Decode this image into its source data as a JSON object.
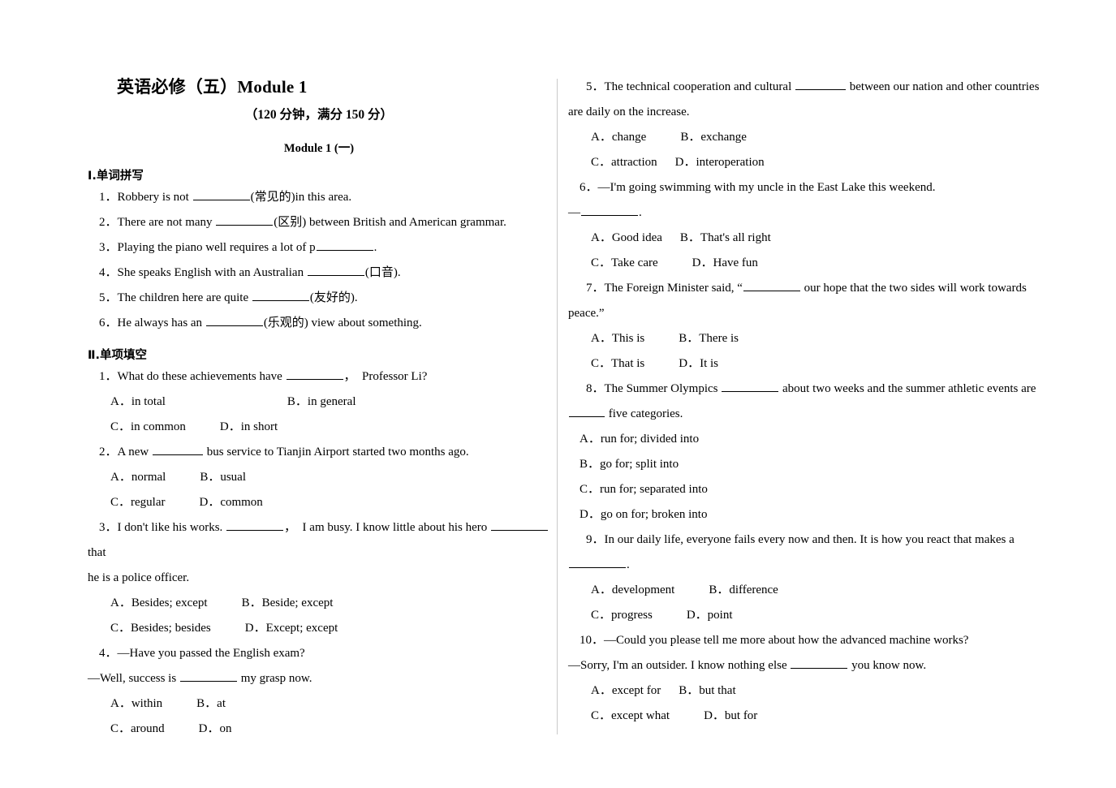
{
  "document": {
    "title": "英语必修（五）Module 1",
    "subtitle": "（120 分钟，满分 150 分）",
    "module_sub": "Module 1 (一)"
  },
  "sections": [
    {
      "id": "spelling",
      "heading": "Ⅰ.单词拼写"
    },
    {
      "id": "multiple_choice",
      "heading": "Ⅱ.单项填空"
    }
  ],
  "spelling_items": [
    {
      "num": "1．",
      "pre": "Robbery is not ",
      "post": "(常见的)in this area."
    },
    {
      "num": "2．",
      "pre": "There are not many ",
      "post": "(区别) between British and American grammar."
    },
    {
      "num": "3．",
      "pre": "Playing the piano well requires a lot of p",
      "post": "."
    },
    {
      "num": "4．",
      "pre": "She speaks English with an Australian ",
      "post": "(口音)."
    },
    {
      "num": "5．",
      "pre": "The children here are quite ",
      "post": "(友好的)."
    },
    {
      "num": "6．",
      "pre": "He always has an ",
      "post": "(乐观的) view about something."
    }
  ],
  "mc_left": [
    {
      "num": "1．",
      "stem_pre": "What do these achievements have ",
      "stem_post": "，　Professor Li?",
      "row1_a": "A．in total",
      "row1_b": "B．in general",
      "row2_a": "C．in common",
      "row2_b": "D．in short"
    },
    {
      "num": "2．",
      "stem_pre": "A new ",
      "stem_post": " bus service to Tianjin Airport started two months ago.",
      "row1_a": "A．normal",
      "row1_b": "B．usual",
      "row2_a": "C．regular",
      "row2_b": "D．common"
    },
    {
      "num": "3．",
      "stem_pre": "I don't like his works. ",
      "stem_mid": "，　I am busy. I know little about his hero ",
      "stem_post": " that",
      "stem_cont": "he is a police officer.",
      "row1_a": "A．Besides; except",
      "row1_b": "B．Beside; except",
      "row2_a": "C．Besides; besides",
      "row2_b": "D．Except; except"
    },
    {
      "num": "4．",
      "stem_line1": "—Have you passed the English exam?",
      "stem_line2_pre": "—Well, success is ",
      "stem_line2_post": " my grasp now.",
      "row1_a": "A．within",
      "row1_b": "B．at",
      "row2_a": "C．around",
      "row2_b": "D．on"
    }
  ],
  "mc_right": [
    {
      "num": "5．",
      "stem_pre": "The technical cooperation and cultural ",
      "stem_post": " between our nation and other countries",
      "stem_cont": "are daily on the increase.",
      "row1_a": "A．change",
      "row1_b": "B．exchange",
      "row2_a": "C．attraction",
      "row2_b": "D．interoperation"
    },
    {
      "num": "6．",
      "stem_line1": "—I'm going swimming with my uncle in the East Lake this weekend.",
      "stem_line2_pre": "—",
      "stem_line2_post": ".",
      "row1_a": "A．Good idea",
      "row1_b": "B．That's all right",
      "row2_a": "C．Take care",
      "row2_b": "D．Have fun"
    },
    {
      "num": "7．",
      "stem_pre": "The Foreign Minister said, “",
      "stem_post": " our hope that the two sides will work towards",
      "stem_cont": "peace.”",
      "row1_a": "A．This is",
      "row1_b": "B．There is",
      "row2_a": "C．That is",
      "row2_b": "D．It is"
    },
    {
      "num": "8．",
      "stem_pre": "The Summer Olympics ",
      "stem_post": " about two weeks and the summer athletic events are",
      "stem_cont_post": " five categories.",
      "opt_a": "A．run for; divided into",
      "opt_b": "B．go for; split into",
      "opt_c": "C．run for; separated into",
      "opt_d": "D．go on for; broken into"
    },
    {
      "num": "9．",
      "stem_line1": "In our daily life, everyone fails every now and then. It is how you react that makes a",
      "stem_cont_post": ".",
      "row1_a": "A．development",
      "row1_b": "B．difference",
      "row2_a": "C．progress",
      "row2_b": "D．point"
    },
    {
      "num": "10．",
      "stem_line1": "—Could you please tell me more about how the advanced machine works?",
      "stem_line2_pre": "—Sorry, I'm an outsider. I know nothing else ",
      "stem_line2_post": " you know now.",
      "row1_a": "A．except for",
      "row1_b": "B．but that",
      "row2_a": "C．except what",
      "row2_b": "D．but for"
    }
  ]
}
